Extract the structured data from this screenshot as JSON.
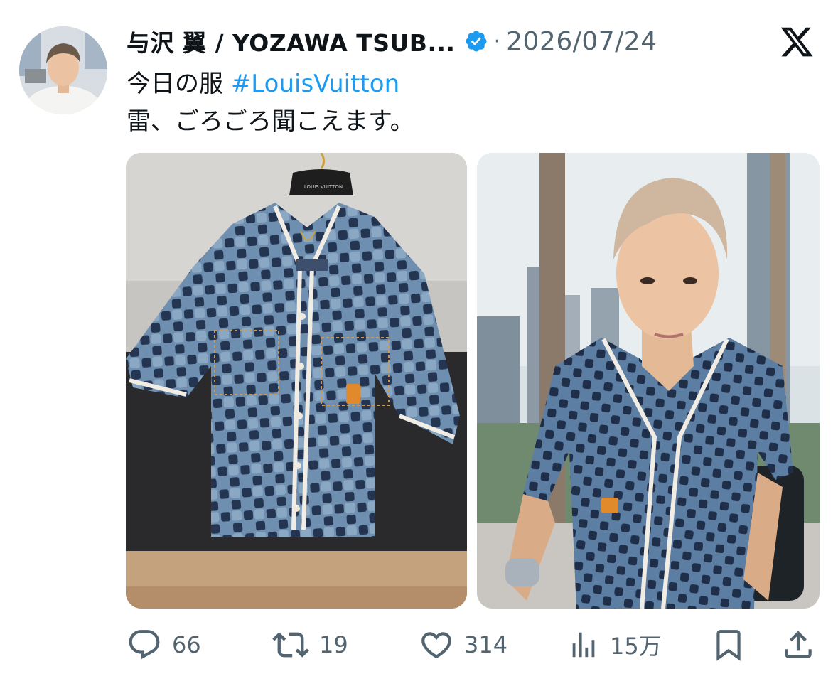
{
  "tweet": {
    "author_name": "与沢 翼 / YOZAWA TSUB...",
    "separator": "·",
    "date": "2026/07/24",
    "text_line1_prefix": "今日の服 ",
    "hashtag": "#LouisVuitton",
    "text_line2": "雷、ごろごろ聞こえます。"
  },
  "media": [
    {
      "alt": "checkered denim baseball shirt on hanger",
      "label_text": "LOUIS VUITTON"
    },
    {
      "alt": "man wearing checkered denim shirt in office"
    }
  ],
  "actions": {
    "replies": "66",
    "reposts": "19",
    "likes": "314",
    "views": "15万"
  },
  "icons": {
    "verified": "verified-badge-icon",
    "platform": "x-logo-icon",
    "reply": "reply-icon",
    "repost": "repost-icon",
    "like": "heart-icon",
    "views": "views-icon",
    "bookmark": "bookmark-icon",
    "share": "share-icon"
  },
  "colors": {
    "link": "#1d9bf0",
    "muted": "#536471",
    "text": "#0f1419"
  }
}
